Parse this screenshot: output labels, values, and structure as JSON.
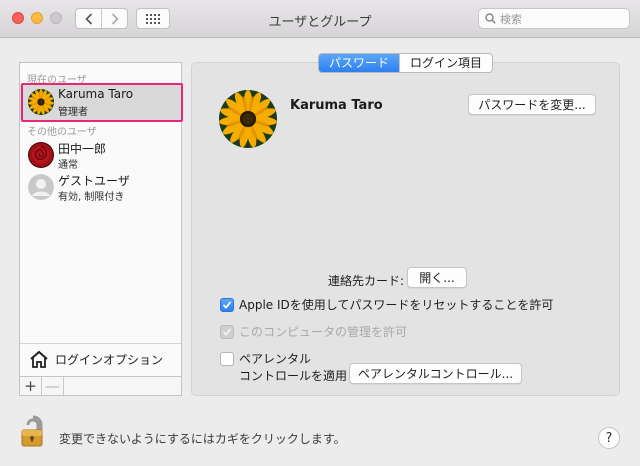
{
  "window": {
    "title": "ユーザとグループ"
  },
  "toolbar": {
    "search_placeholder": "検索"
  },
  "sidebar": {
    "current_section": "現在のユーザ",
    "other_section": "その他のユーザ",
    "users": [
      {
        "name": "Karuma Taro",
        "role": "管理者",
        "avatar": "sunflower-avatar",
        "selected": true
      },
      {
        "name": "田中一郎",
        "role": "通常",
        "avatar": "rose-avatar"
      },
      {
        "name": "ゲストユーザ",
        "role": "有効, 制限付き",
        "avatar": "person-silhouette-icon"
      }
    ],
    "login_options": "ログインオプション",
    "add": "+",
    "remove": "—"
  },
  "tabs": [
    {
      "label": "パスワード",
      "active": true
    },
    {
      "label": "ログイン項目",
      "active": false
    }
  ],
  "detail": {
    "name": "Karuma Taro",
    "change_password": "パスワードを変更...",
    "contact_card_label": "連絡先カード:",
    "open": "開く...",
    "allow_apple_id": "Apple IDを使用してパスワードをリセットすることを許可",
    "allow_admin": "このコンピュータの管理を許可",
    "parental_line1": "ペアレンタル",
    "parental_line2": "コントロールを適用",
    "parental_button": "ペアレンタルコントロール..."
  },
  "footer": {
    "lock_text": "変更できないようにするにはカギをクリックします。",
    "help": "?"
  },
  "colors": {
    "accent": "#2f7ff0",
    "highlight": "#e8277a"
  }
}
